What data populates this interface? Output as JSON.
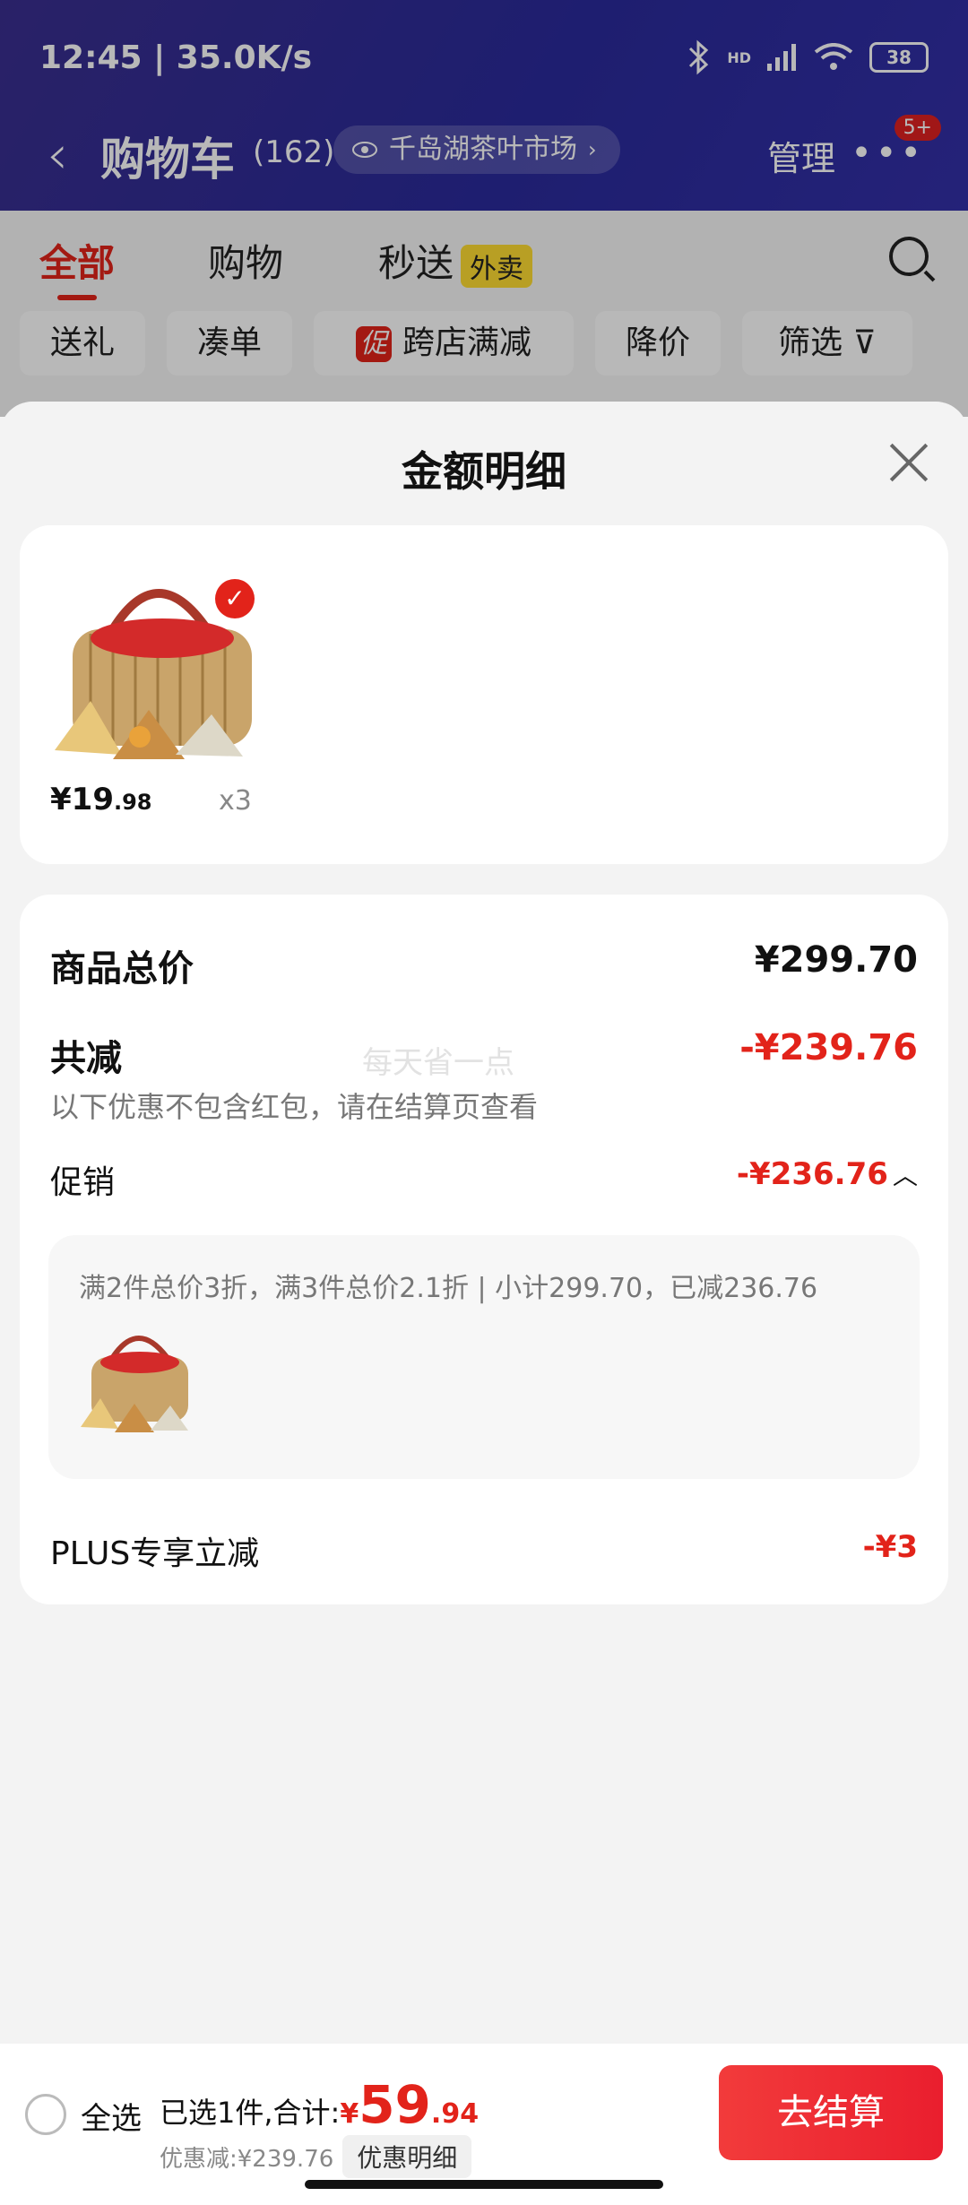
{
  "status_bar": {
    "time": "12:45 | 35.0K/s",
    "battery": "38",
    "hd": "HD",
    "wifi_sub": "6"
  },
  "header": {
    "back_icon": "chevron-left-icon",
    "title": "购物车",
    "count": "(162)",
    "store": "千岛湖茶叶市场",
    "manage": "管理",
    "more_badge": "5+"
  },
  "tabs": [
    {
      "label": "全部",
      "active": true
    },
    {
      "label": "购物",
      "active": false
    },
    {
      "label": "秒送",
      "active": false,
      "badge": "外卖"
    }
  ],
  "filters": [
    {
      "label": "送礼"
    },
    {
      "label": "凑单"
    },
    {
      "label": "跨店满减",
      "tag": "促"
    },
    {
      "label": "降价"
    },
    {
      "label": "筛选"
    }
  ],
  "sheet": {
    "title": "金额明细",
    "item": {
      "price_int": "¥19",
      "price_dec": ".98",
      "qty": "x3"
    },
    "total_label": "商品总价",
    "total_value": "¥299.70",
    "reduce_label": "共减",
    "reduce_value": "-¥239.76",
    "note": "以下优惠不包含红包，请在结算页查看",
    "watermark": "每天省一点",
    "promo_label": "促销",
    "promo_value": "-¥236.76",
    "promo_detail": "满2件总价3折，满3件总价2.1折 | 小计299.70，已减236.76",
    "plus_label": "PLUS专享立减",
    "plus_value": "-¥3"
  },
  "bottom": {
    "select_all": "全选",
    "selected_text": "已选1件,合计:",
    "currency": "¥",
    "amount_int": "59",
    "amount_dec": ".94",
    "discount_text": "优惠减:¥239.76",
    "detail_btn": "优惠明细",
    "checkout": "去结算"
  },
  "colors": {
    "accent": "#e2231a",
    "header_bg": "#2a2a9b"
  }
}
